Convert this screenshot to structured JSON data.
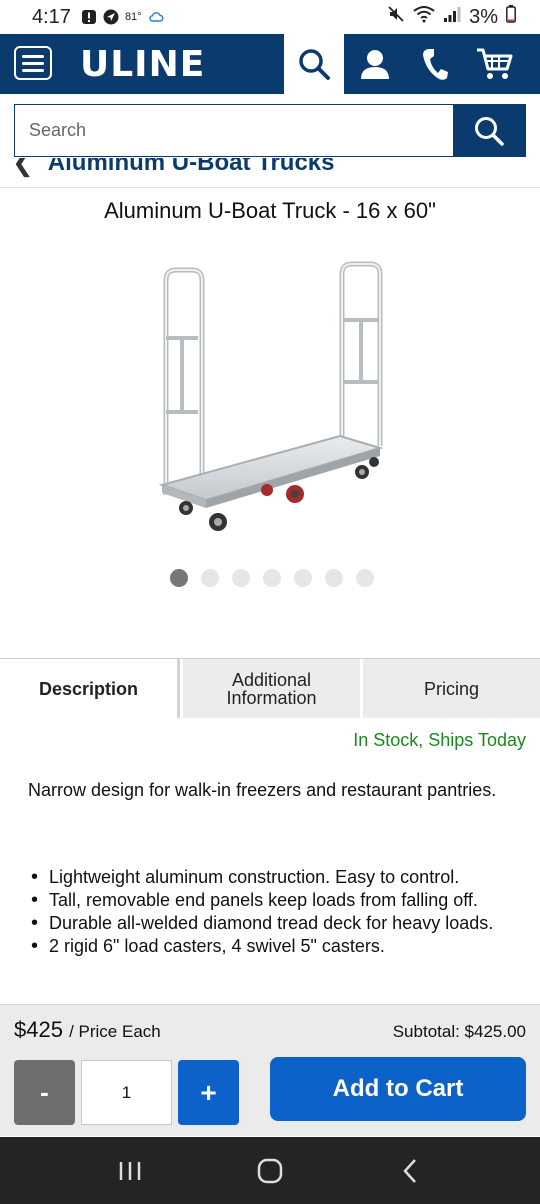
{
  "status_bar": {
    "time": "4:17",
    "temperature": "81°",
    "battery": "3%"
  },
  "header": {
    "logo": "ULINE",
    "icons": [
      "menu-icon",
      "search-icon",
      "account-icon",
      "phone-icon",
      "cart-icon"
    ],
    "brand_color": "#0b3a6e"
  },
  "search": {
    "placeholder": "Search"
  },
  "breadcrumb": {
    "label": "Aluminum U-Boat Trucks"
  },
  "product": {
    "title": "Aluminum U-Boat Truck - 16 x 60\"",
    "image_count": 7,
    "active_image": 1
  },
  "tabs": [
    {
      "label": "Description",
      "active": true
    },
    {
      "label": "Additional Information",
      "active": false
    },
    {
      "label": "Pricing",
      "active": false
    }
  ],
  "stock_status": "In Stock, Ships Today",
  "description": "Narrow design for walk-in freezers and restaurant pantries.",
  "features": [
    "Lightweight aluminum construction. Easy to control.",
    "Tall, removable end panels keep loads from falling off.",
    "Durable all-welded diamond tread deck for heavy loads.",
    "2 rigid 6\" load casters, 4 swivel 5\" casters."
  ],
  "purchase": {
    "price": "$425",
    "price_unit": "/ Price Each",
    "subtotal": "Subtotal: $425.00",
    "minus_label": "-",
    "quantity": "1",
    "plus_label": "+",
    "add_to_cart": "Add to Cart",
    "button_color": "#0d62c9"
  },
  "colors": {
    "in_stock": "#1b8a1b"
  }
}
